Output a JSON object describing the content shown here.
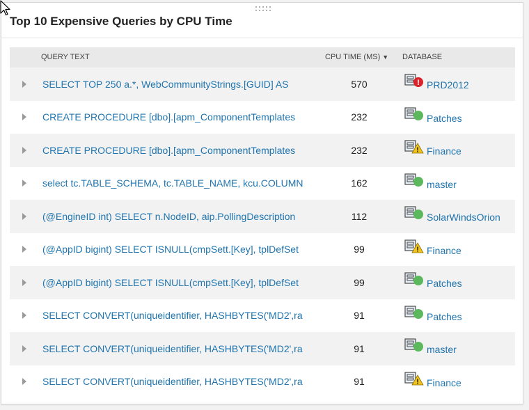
{
  "widget": {
    "title": "Top 10 Expensive Queries by CPU Time"
  },
  "colors": {
    "link": "#1f74ae",
    "status_up": "#5cb85c",
    "status_warning": "#f0c419",
    "status_critical": "#d9232a"
  },
  "table": {
    "columns": {
      "query_text": "QUERY TEXT",
      "cpu_time": "CPU TIME (MS)",
      "cpu_sort_indicator": "▼",
      "database": "DATABASE"
    },
    "rows": [
      {
        "query": "SELECT TOP 250 a.*, WebCommunityStrings.[GUID] AS",
        "cpu": "570",
        "database": "PRD2012",
        "status": "critical"
      },
      {
        "query": "CREATE PROCEDURE [dbo].[apm_ComponentTemplates",
        "cpu": "232",
        "database": "Patches",
        "status": "up"
      },
      {
        "query": "CREATE PROCEDURE [dbo].[apm_ComponentTemplates",
        "cpu": "232",
        "database": "Finance",
        "status": "warning"
      },
      {
        "query": "select tc.TABLE_SCHEMA, tc.TABLE_NAME, kcu.COLUMN",
        "cpu": "162",
        "database": "master",
        "status": "up"
      },
      {
        "query": "(@EngineID int) SELECT n.NodeID, aip.PollingDescription",
        "cpu": "112",
        "database": "SolarWindsOrion",
        "status": "up"
      },
      {
        "query": "(@AppID bigint) SELECT ISNULL(cmpSett.[Key], tplDefSet",
        "cpu": "99",
        "database": "Finance",
        "status": "warning"
      },
      {
        "query": "(@AppID bigint) SELECT ISNULL(cmpSett.[Key], tplDefSet",
        "cpu": "99",
        "database": "Patches",
        "status": "up"
      },
      {
        "query": "SELECT CONVERT(uniqueidentifier, HASHBYTES('MD2',ra",
        "cpu": "91",
        "database": "Patches",
        "status": "up"
      },
      {
        "query": "SELECT CONVERT(uniqueidentifier, HASHBYTES('MD2',ra",
        "cpu": "91",
        "database": "master",
        "status": "up"
      },
      {
        "query": "SELECT CONVERT(uniqueidentifier, HASHBYTES('MD2',ra",
        "cpu": "91",
        "database": "Finance",
        "status": "warning"
      }
    ]
  }
}
